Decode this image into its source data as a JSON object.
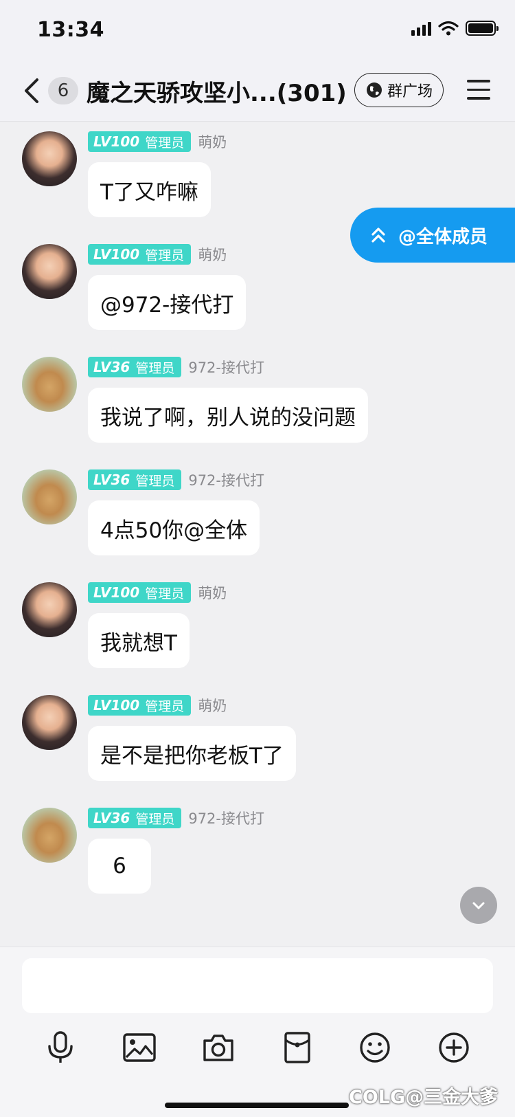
{
  "status_bar": {
    "time": "13:34"
  },
  "nav": {
    "unread_count": "6",
    "title": "魔之天骄攻坚小...(301)",
    "plaza_label": "群广场"
  },
  "level_tag_role": "管理员",
  "mention_bar": {
    "label": "@全体成员"
  },
  "messages": [
    {
      "level": "LV100",
      "sender": "萌奶",
      "text": "T了又咋嘛",
      "avatar": "dark-haired-boy-avatar"
    },
    {
      "level": "LV100",
      "sender": "萌奶",
      "text": "@972-接代打",
      "avatar": "dark-haired-boy-avatar"
    },
    {
      "level": "LV36",
      "sender": "972-接代打",
      "text": "我说了啊，别人说的没问题",
      "avatar": "muscle-torso-avatar"
    },
    {
      "level": "LV36",
      "sender": "972-接代打",
      "text": "4点50你@全体",
      "avatar": "muscle-torso-avatar"
    },
    {
      "level": "LV100",
      "sender": "萌奶",
      "text": "我就想T",
      "avatar": "dark-haired-boy-avatar"
    },
    {
      "level": "LV100",
      "sender": "萌奶",
      "text": "是不是把你老板T了",
      "avatar": "dark-haired-boy-avatar"
    },
    {
      "level": "LV36",
      "sender": "972-接代打",
      "text": "6",
      "avatar": "muscle-torso-avatar"
    }
  ],
  "input": {
    "placeholder": ""
  },
  "toolbar_icons": [
    "microphone-icon",
    "image-icon",
    "camera-icon",
    "red-packet-icon",
    "emoji-icon",
    "plus-icon"
  ],
  "watermark": "COLG@三金大爹",
  "colors": {
    "accent_blue": "#159bf0",
    "level_tag": "#3fd6c8",
    "bubble": "#ffffff",
    "background": "#f0f0f2"
  }
}
